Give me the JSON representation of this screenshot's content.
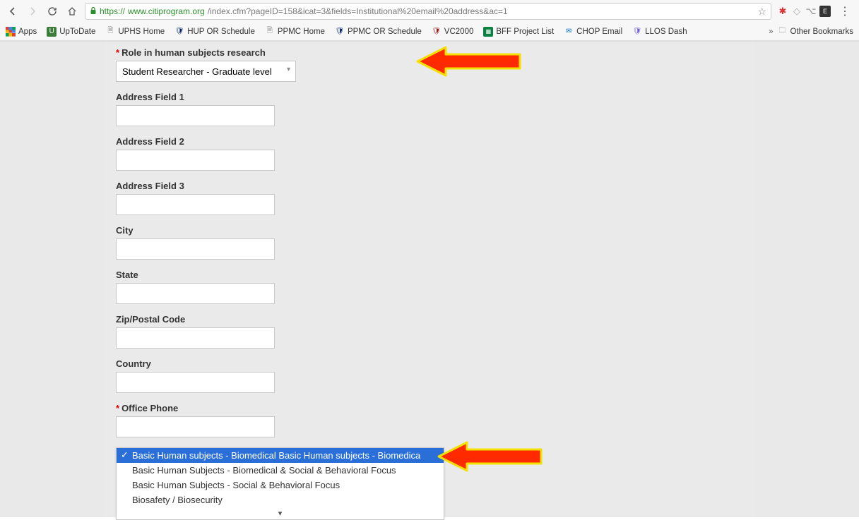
{
  "browser": {
    "url_https": "https://",
    "url_domain": "www.citiprogram.org",
    "url_path": "/index.cfm?pageID=158&icat=3&fields=Institutional%20email%20address&ac=1"
  },
  "bookmarks": {
    "apps": "Apps",
    "items": [
      {
        "label": "UpToDate"
      },
      {
        "label": "UPHS Home"
      },
      {
        "label": "HUP OR Schedule"
      },
      {
        "label": "PPMC Home"
      },
      {
        "label": "PPMC OR Schedule"
      },
      {
        "label": "VC2000"
      },
      {
        "label": "BFF Project List"
      },
      {
        "label": "CHOP Email"
      },
      {
        "label": "LLOS Dash"
      }
    ],
    "other": "Other Bookmarks"
  },
  "form": {
    "role_label": "Role in human subjects research",
    "role_value": "Student Researcher - Graduate level",
    "fields": [
      {
        "label": "Address Field 1"
      },
      {
        "label": "Address Field 2"
      },
      {
        "label": "Address Field 3"
      },
      {
        "label": "City"
      },
      {
        "label": "State"
      },
      {
        "label": "Zip/Postal Code"
      },
      {
        "label": "Country"
      }
    ],
    "office_phone": "Office Phone",
    "dropdown": {
      "options": [
        "Basic Human subjects - Biomedical Basic Human subjects - Biomedica",
        "Basic Human Subjects - Biomedical & Social & Behavioral Focus",
        "Basic Human Subjects - Social & Behavioral Focus",
        "Biosafety / Biosecurity"
      ]
    }
  }
}
